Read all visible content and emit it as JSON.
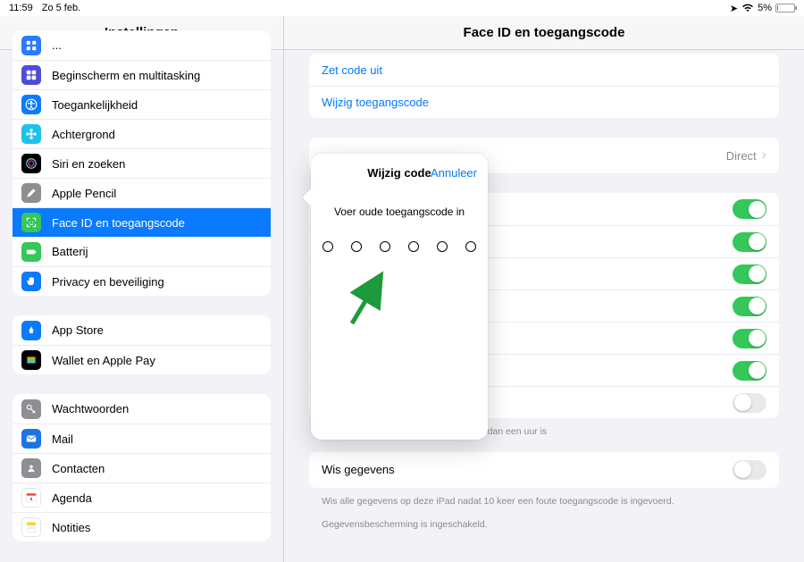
{
  "statusbar": {
    "time": "11:59",
    "date": "Zo 5 feb.",
    "battery_pct": "5%"
  },
  "sidebar": {
    "title": "Instellingen",
    "groups": [
      {
        "items": [
          {
            "label": "...",
            "icon_bg": "#2c79ff",
            "icon": "grid",
            "truncated": true
          },
          {
            "label": "Beginscherm en multitasking",
            "icon_bg": "#4e4cd9",
            "icon": "home"
          },
          {
            "label": "Toegankelijkheid",
            "icon_bg": "#0a7aff",
            "icon": "accessibility"
          },
          {
            "label": "Achtergrond",
            "icon_bg": "#1cc2e8",
            "icon": "flower"
          },
          {
            "label": "Siri en zoeken",
            "icon_bg": "#000",
            "icon": "siri"
          },
          {
            "label": "Apple Pencil",
            "icon_bg": "#8e8e93",
            "icon": "pencil"
          },
          {
            "label": "Face ID en toegangscode",
            "icon_bg": "#34c759",
            "icon": "faceid",
            "selected": true
          },
          {
            "label": "Batterij",
            "icon_bg": "#34c759",
            "icon": "battery"
          },
          {
            "label": "Privacy en beveiliging",
            "icon_bg": "#0a7aff",
            "icon": "hand"
          }
        ]
      },
      {
        "items": [
          {
            "label": "App Store",
            "icon_bg": "#0a7aff",
            "icon": "appstore"
          },
          {
            "label": "Wallet en Apple Pay",
            "icon_bg": "#000",
            "icon": "wallet"
          }
        ]
      },
      {
        "items": [
          {
            "label": "Wachtwoorden",
            "icon_bg": "#8e8e93",
            "icon": "key"
          },
          {
            "label": "Mail",
            "icon_bg": "#1c73e8",
            "icon": "mail"
          },
          {
            "label": "Contacten",
            "icon_bg": "#8e8e93",
            "icon": "contacts"
          },
          {
            "label": "Agenda",
            "icon_bg": "#fff",
            "icon": "calendar"
          },
          {
            "label": "Notities",
            "icon_bg": "#fff",
            "icon": "notes"
          }
        ]
      }
    ]
  },
  "detail": {
    "title": "Face ID en toegangscode",
    "links": {
      "disable": "Zet code uit",
      "change": "Wijzig toegangscode"
    },
    "require": {
      "value": "Direct"
    },
    "toggles": [
      true,
      true,
      true,
      true,
      true,
      true,
      false
    ],
    "toggle_footnote": "g te laten maken wanneer je iPad meer dan een uur is",
    "erase": {
      "label": "Wis gegevens"
    },
    "erase_footnote1": "Wis alle gegevens op deze iPad nadat 10 keer een foute toegangscode is ingevoerd.",
    "erase_footnote2": "Gegevensbescherming is ingeschakeld."
  },
  "popover": {
    "title": "Wijzig code",
    "cancel": "Annuleer",
    "prompt": "Voer oude toegangscode in"
  }
}
